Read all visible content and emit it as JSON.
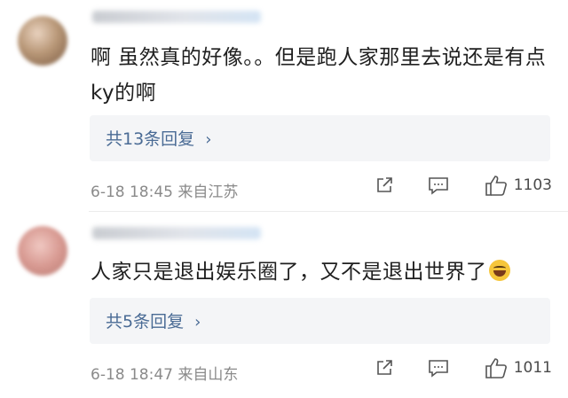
{
  "comments": [
    {
      "text": "啊 虽然真的好像。。但是跑人家那里去说还是有点ky的啊",
      "replies_label": "共13条回复",
      "timestamp": "6-18 18:45",
      "location": "来自江苏",
      "likes": "1103"
    },
    {
      "text": "人家只是退出娱乐圈了，又不是退出世界了",
      "replies_label": "共5条回复",
      "timestamp": "6-18 18:47",
      "location": "来自山东",
      "likes": "1011"
    }
  ],
  "icons": {
    "share": "share-icon",
    "comment": "comment-icon",
    "like": "thumbs-up-icon",
    "emoji": "laughing-tears-emoji",
    "chevron": "chevron-right-icon"
  },
  "colors": {
    "link": "#4a6b95",
    "meta": "#8a8a8a",
    "reply_bg": "#f4f5f7"
  }
}
